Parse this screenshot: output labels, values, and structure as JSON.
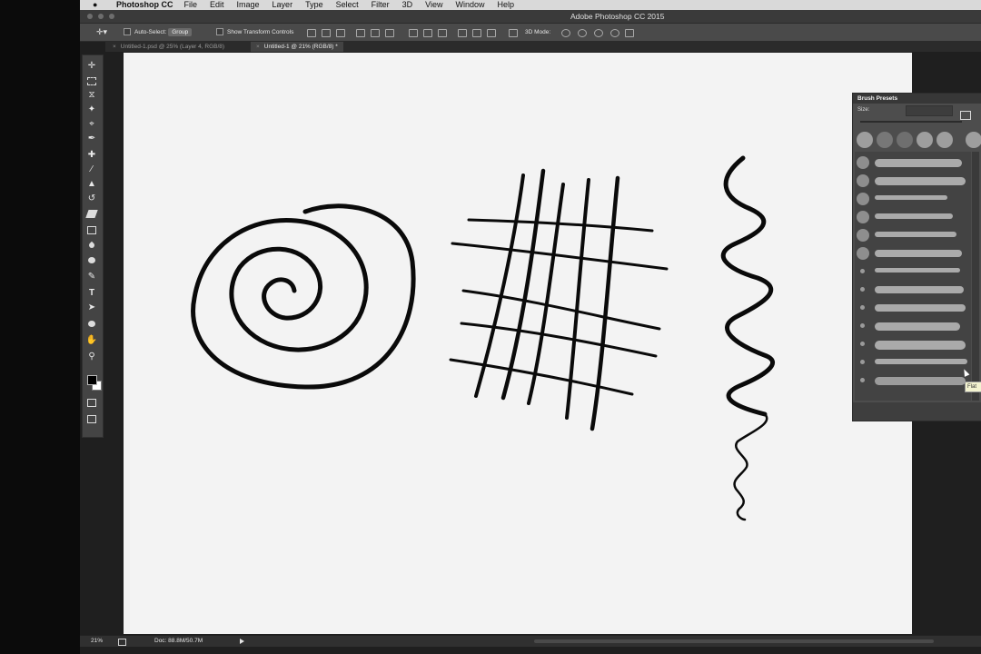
{
  "menubar": {
    "app_name": "Photoshop CC",
    "items": [
      "File",
      "Edit",
      "Image",
      "Layer",
      "Type",
      "Select",
      "Filter",
      "3D",
      "View",
      "Window",
      "Help"
    ]
  },
  "titlebar": {
    "title": "Adobe Photoshop CC 2015"
  },
  "options": {
    "auto_select_label": "Auto-Select:",
    "auto_select_value": "Group",
    "transform_label": "Show Transform Controls",
    "mode_3d_label": "3D Mode:"
  },
  "tabs": [
    {
      "label": "Untitled-1.psd @ 25% (Layer 4, RGB/8)"
    },
    {
      "label": "Untitled-1 @ 21% (RGB/8) *"
    }
  ],
  "panel": {
    "title": "Brush Presets",
    "size_label": "Size:",
    "tooltip": "Flat"
  },
  "status": {
    "zoom": "21%",
    "doc": "Doc: 88.8M/50.7M"
  },
  "icons": {
    "move": "move-icon",
    "marquee": "marquee-icon",
    "lasso": "lasso-icon",
    "magic": "magic-wand-icon",
    "crop": "crop-icon",
    "eyedropper": "eyedropper-icon",
    "healing": "healing-brush-icon",
    "brush": "brush-icon",
    "stamp": "clone-stamp-icon",
    "history": "history-brush-icon",
    "eraser": "eraser-icon",
    "gradient": "gradient-icon",
    "blur": "blur-icon",
    "dodge": "dodge-icon",
    "pen": "pen-icon",
    "type": "type-icon",
    "path": "path-selection-icon",
    "shape": "ellipse-icon",
    "hand": "hand-icon",
    "zoom": "zoom-icon"
  }
}
